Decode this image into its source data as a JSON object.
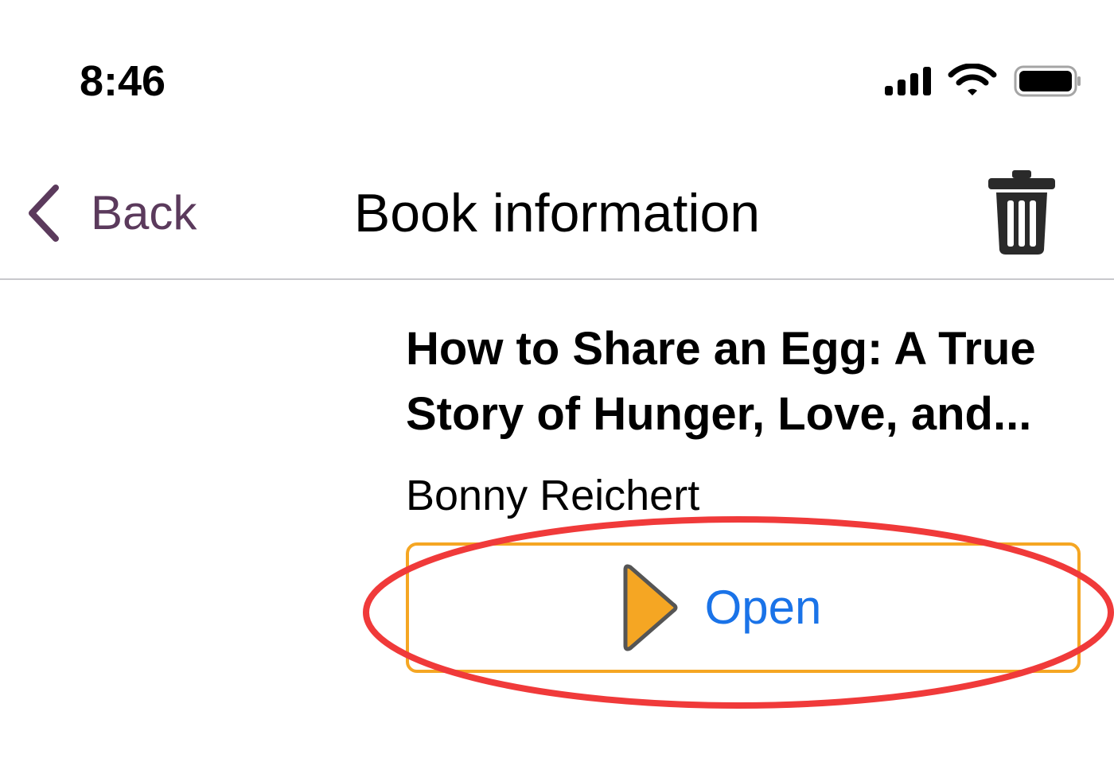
{
  "status_bar": {
    "time": "8:46",
    "icons": [
      "cellular-signal-icon",
      "wifi-icon",
      "battery-icon"
    ]
  },
  "nav_bar": {
    "back_label": "Back",
    "title": "Book information",
    "back_icon": "chevron-left-icon",
    "delete_icon": "trash-icon"
  },
  "book": {
    "title": "How to Share an Egg: A True\nStory of Hunger, Love, and...",
    "author": "Bonny Reichert"
  },
  "open_button": {
    "label": "Open",
    "icon": "play-icon"
  },
  "colors": {
    "back_accent": "#5b3a5c",
    "button_border": "#f5a623",
    "button_label": "#1a73e8",
    "play_fill": "#f5a623",
    "highlight_ring": "#f03a3a"
  }
}
